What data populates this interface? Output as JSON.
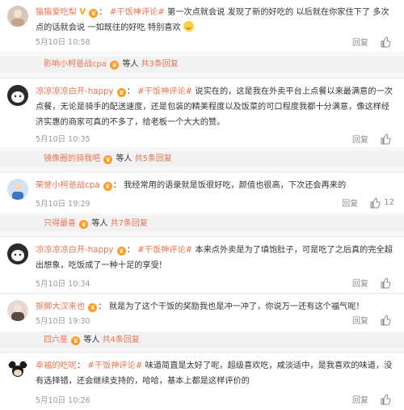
{
  "comments": [
    {
      "username": "猫猫爱吃梨",
      "v_mark": "V",
      "topic": "#干饭神评论#",
      "text": "第一次点就会说 发现了新的好吃的 以后就在你家住下了 多次点的话就会说 一如既往的好吃 特别喜欢",
      "time": "5月10日 10:58",
      "reply_label": "回复",
      "like_count": ""
    },
    {
      "username": "凉凉凉凉白开-happy",
      "topic": "#干饭神评论#",
      "text": "说实在的，这是我在外卖平台上点餐以来最满意的一次点餐，无论是骑手的配送速度，还是包装的精美程度以及饭菜的可口程度我都十分满意，像这样经济实惠的商家可真的不多了，给老板一个大大的赞。",
      "time": "5月10日 10:35",
      "reply_label": "回复",
      "like_count": ""
    },
    {
      "username": "荣誉小柯爸战cpa",
      "text": "我经常用的语录就是饭很好吃，颜值也很高，下次还会再来的",
      "time": "5月10日 19:29",
      "reply_label": "回复",
      "like_count": "12"
    },
    {
      "username": "凉凉凉凉白开-happy",
      "topic": "#干饭神评论#",
      "text": "本来点外卖是为了填饱肚子，可是吃了之后真的完全超出想象，吃饭成了一种十足的享受!",
      "time": "5月10日 10:34",
      "reply_label": "回复",
      "like_count": ""
    },
    {
      "username": "抠脚大汉来也",
      "text": "就是为了这个干饭的奖励我也是冲一冲了，你说万一还有这个福气呢！",
      "time": "5月10日 19:30",
      "reply_label": "回复",
      "like_count": ""
    },
    {
      "username": "幸福的吃呢",
      "topic": "#干饭神评论#",
      "text": "味道简直是太好了呢，超级喜欢吃，咸淡适中，是我喜欢的味道，没有选择错，还会继续支持的，哈哈，基本上都是这样评价的",
      "time": "5月10日 10:26",
      "reply_label": "回复",
      "like_count": ""
    }
  ],
  "reply_strips": [
    {
      "username": "影响小柯爸战cpa",
      "middle": "等人",
      "more": "共3条回复"
    },
    {
      "username": "镜像圈的骑我吧",
      "middle": "等人",
      "more": "共5条回复"
    },
    {
      "username": "只得最喜",
      "middle": "等人",
      "more": "共7条回复"
    },
    {
      "username": "四六星",
      "middle": "等人",
      "more": "共4条回复"
    }
  ],
  "colors": {
    "accent": "#eb7350",
    "badge": "#ff9a1f",
    "muted": "#9a9a9a"
  }
}
